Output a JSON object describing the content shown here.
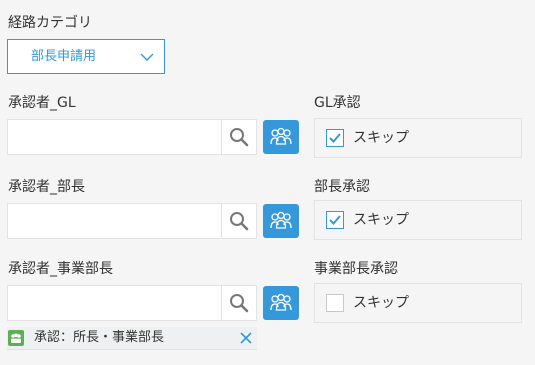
{
  "category": {
    "label": "経路カテゴリ",
    "selected_value": "部長申請用",
    "chevron_icon": "chevron-down-icon"
  },
  "approvers": [
    {
      "label": "承認者_GL",
      "input_value": "",
      "search_icon": "search-icon",
      "org_icon": "organization-icon",
      "approval_label": "GL承認",
      "skip_label": "スキップ",
      "skip_checked": true
    },
    {
      "label": "承認者_部長",
      "input_value": "",
      "search_icon": "search-icon",
      "org_icon": "organization-icon",
      "approval_label": "部長承認",
      "skip_label": "スキップ",
      "skip_checked": true
    },
    {
      "label": "承認者_事業部長",
      "input_value": "",
      "search_icon": "search-icon",
      "org_icon": "organization-icon",
      "approval_label": "事業部長承認",
      "skip_label": "スキップ",
      "skip_checked": false
    }
  ],
  "selected_entity": {
    "text": "承認：所長・事業部長",
    "icon": "role-group-icon",
    "remove_icon": "close-icon"
  },
  "colors": {
    "accent": "#3498db",
    "chip_icon": "#5fad56",
    "background": "#f5f5f5",
    "border": "#e3e3e3"
  }
}
